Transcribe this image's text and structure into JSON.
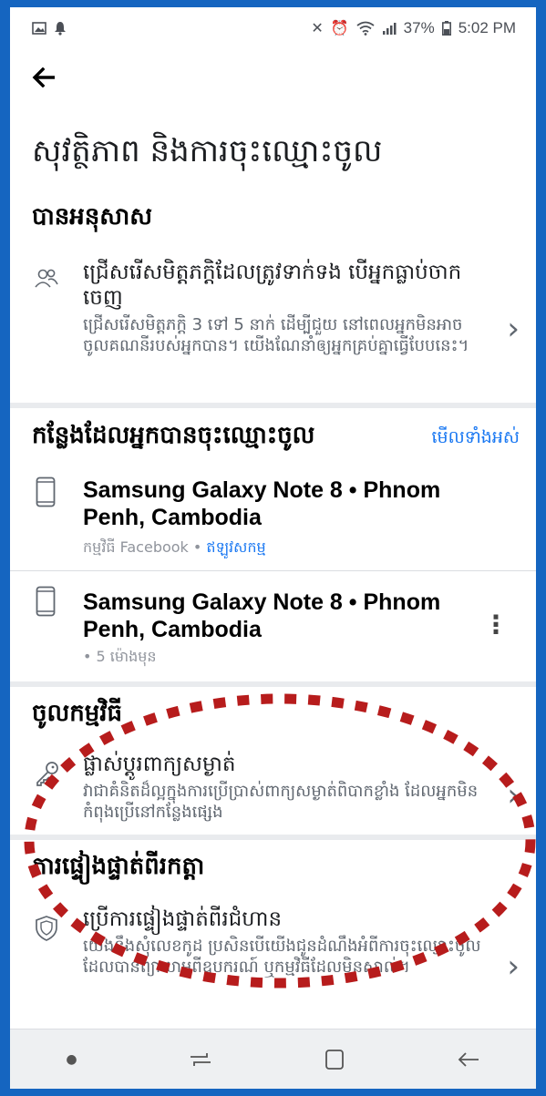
{
  "status_bar": {
    "left_icons": [
      "image-icon",
      "notification-icon"
    ],
    "right_icons": [
      "mute-icon",
      "alarm-icon",
      "wifi-icon",
      "signal-icon"
    ],
    "battery": "37%",
    "time": "5:02 PM"
  },
  "header": {
    "back_icon": "back-arrow-icon",
    "title": "សុវត្ថិភាព និងការចុះឈ្មោះចូល"
  },
  "recommended": {
    "title": "បានអនុសាស",
    "item": {
      "icon": "friends-icon",
      "title": "ជ្រើសរើសមិត្តភក្តិដែលត្រូវទាក់ទង បើអ្នកធ្លាប់ចាកចេញ",
      "desc": "ជ្រើសរើសមិត្តភក្តិ 3 ទៅ 5 នាក់ ដើម្បីជួយ នៅពេលអ្នកមិនអាចចូលគណនីរបស់អ្នកបាន។ យើងណែនាំឲ្យអ្នកគ្រប់គ្នាធ្វើបែបនេះ។"
    }
  },
  "logged_in": {
    "title": "កន្លែងដែលអ្នកបានចុះឈ្មោះចូល",
    "see_all": "មើលទាំងអស់",
    "devices": [
      {
        "name": "Samsung Galaxy Note 8 • Phnom Penh, Cambodia",
        "app_label": "កម្មវិធី Facebook • ",
        "status": "ឥឡូវសកម្ម"
      },
      {
        "name": "Samsung Galaxy Note 8 • Phnom Penh, Cambodia",
        "time": "• 5 ម៉ោងមុន"
      }
    ]
  },
  "login": {
    "title": "ចូលកម្មវិធី",
    "item": {
      "icon": "key-icon",
      "title": "ផ្លាស់ប្តូរពាក្យសម្ងាត់",
      "desc": "វាជាគំនិតដ៏ល្អក្នុងការប្រើប្រាស់ពាក្យសម្ងាត់ពិបាកខ្លាំង ដែលអ្នកមិនកំពុងប្រើនៅកន្លែងផ្សេង"
    }
  },
  "two_factor": {
    "title": "ការផ្ទៀងផ្ទាត់ពីរកត្តា",
    "item": {
      "icon": "shield-icon",
      "title": "ប្រើការផ្ទៀងផ្ទាត់ពីរជំហាន",
      "desc": "យើងនឹងសុំលេខកូដ ប្រសិនបើយើងជូនដំណឹងអំពីការចុះឈ្មោះចូលដែលបានព្យាយាមពីឧបករណ៍ ឬកម្មវិធីដែលមិនស្គាល់។"
    }
  },
  "highlight_color": "#b71c1c",
  "accent_color": "#1877f2",
  "frame_color": "#1565c0",
  "nav_bar": {
    "icons": [
      "dot-icon",
      "recent-apps-icon",
      "home-icon",
      "nav-back-icon"
    ]
  }
}
